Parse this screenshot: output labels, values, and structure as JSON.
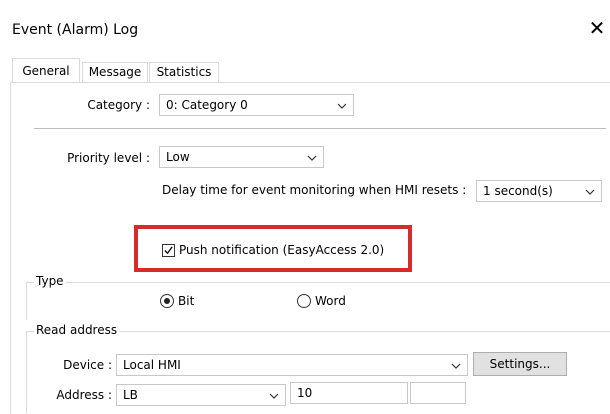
{
  "window": {
    "title": "Event (Alarm) Log",
    "close_glyph": "✕"
  },
  "tabs": [
    {
      "label": "General"
    },
    {
      "label": "Message"
    },
    {
      "label": "Statistics"
    }
  ],
  "general": {
    "category_label": "Category :",
    "category_value": "0: Category 0",
    "priority_label": "Priority level :",
    "priority_value": "Low",
    "delay_label": "Delay time for event monitoring when HMI resets :",
    "delay_value": "1 second(s)",
    "push_label": "Push notification (EasyAccess 2.0)",
    "push_checked": true
  },
  "type": {
    "group_label": "Type",
    "bit_label": "Bit",
    "word_label": "Word",
    "selected": "Bit"
  },
  "read_address": {
    "group_label": "Read address",
    "device_label": "Device :",
    "device_value": "Local HMI",
    "settings_label": "Settings...",
    "address_label": "Address :",
    "address_type_value": "LB",
    "address_value": "10"
  },
  "colors": {
    "highlight": "#d62b2b",
    "border": "#d9d9d9",
    "button_bg": "#e1e1e1"
  }
}
